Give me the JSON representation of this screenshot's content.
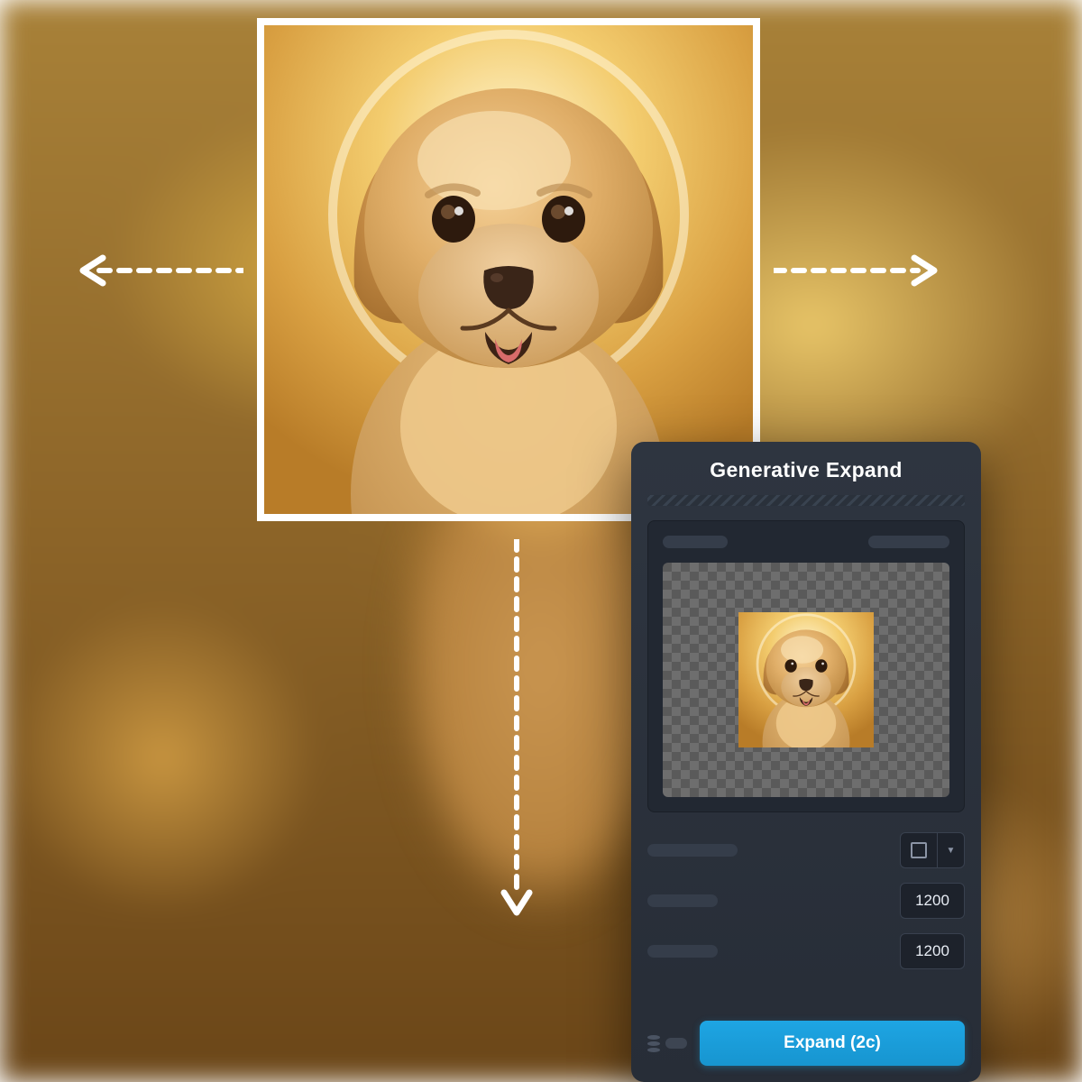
{
  "panel": {
    "title": "Generative Expand",
    "width_value": "1200",
    "height_value": "1200",
    "expand_button_label": "Expand (2c)"
  },
  "icons": {
    "arrow_left": "arrow-left-dashed",
    "arrow_right": "arrow-right-dashed",
    "arrow_down": "arrow-down-dashed",
    "aspect_square": "square-aspect",
    "caret": "▼",
    "credits": "credits-stack"
  },
  "colors": {
    "panel_bg": "#2a313b",
    "accent": "#1ea5e3",
    "text": "#ffffff",
    "skeleton": "#353d4a"
  }
}
